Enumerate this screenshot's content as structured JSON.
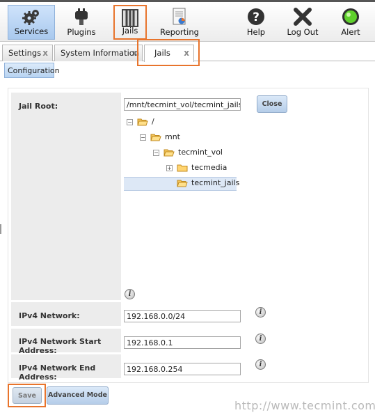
{
  "toolbar": {
    "services": "Services",
    "plugins": "Plugins",
    "jails": "Jails",
    "reporting": "Reporting",
    "help": "Help",
    "logout": "Log Out",
    "alert": "Alert"
  },
  "tabs": [
    {
      "label": "Settings"
    },
    {
      "label": "System Information"
    },
    {
      "label": "Jails"
    }
  ],
  "tab_close_glyph": "x",
  "subnav": {
    "configuration": "Configuration"
  },
  "form": {
    "jail_root_label": "Jail Root:",
    "jail_root_value": "/mnt/tecmint_vol/tecmint_jails",
    "close_label": "Close",
    "ipv4_network_label": "IPv4 Network:",
    "ipv4_network_value": "192.168.0.0/24",
    "ipv4_start_label": "IPv4 Network Start Address:",
    "ipv4_start_value": "192.168.0.1",
    "ipv4_end_label": "IPv4 Network End Address:",
    "ipv4_end_value": "192.168.0.254"
  },
  "tree": {
    "root": "/",
    "mnt": "mnt",
    "vol": "tecmint_vol",
    "media": "tecmedia",
    "jails": "tecmint_jails",
    "expanded_glyph": "−",
    "collapsed_glyph": "+"
  },
  "info_glyph": "i",
  "buttons": {
    "save": "Save",
    "advanced_mode": "Advanced Mode"
  },
  "watermark": "http://www.tecmint.com",
  "colors": {
    "highlight": "#e8742c",
    "selected_tab": "#cfe3fb"
  }
}
